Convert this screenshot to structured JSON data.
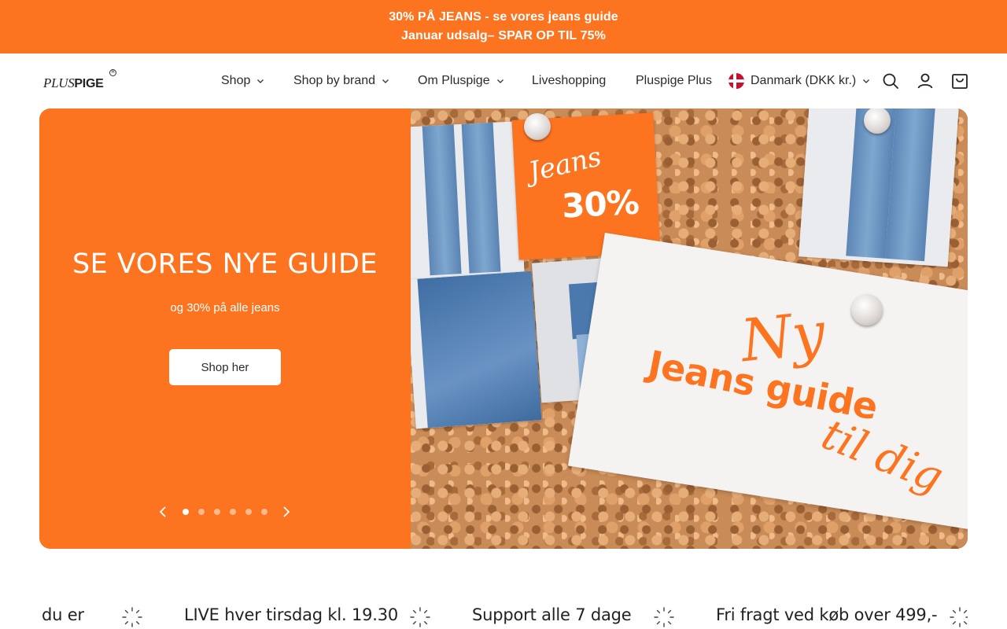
{
  "announcement": {
    "line1": "30% PÅ JEANS - se vores jeans guide",
    "line2": "Januar udsalg– SPAR OP TIL 75%"
  },
  "header": {
    "logo_text": "PLUSPIGE",
    "logo_plus": "PLUS",
    "logo_pige": "PIGE",
    "nav": [
      {
        "label": "Shop",
        "has_dropdown": true
      },
      {
        "label": "Shop by brand",
        "has_dropdown": true
      },
      {
        "label": "Om Pluspige",
        "has_dropdown": true
      },
      {
        "label": "Liveshopping",
        "has_dropdown": false
      },
      {
        "label": "Pluspige Plus",
        "has_dropdown": false
      }
    ],
    "country": {
      "label": "Danmark (DKK kr.)",
      "flag": "denmark-flag"
    },
    "icons": [
      "search-icon",
      "account-icon",
      "cart-icon"
    ]
  },
  "hero": {
    "title": "SE VORES NYE GUIDE",
    "subtitle": "og 30% på alle jeans",
    "button": "Shop her",
    "slide_count": 6,
    "active_slide": 1,
    "image": {
      "card_script": "Jeans",
      "card_percent": "30%",
      "tag_line1": "Ny",
      "tag_line2": "Jeans guide",
      "tag_line3": "til dig"
    }
  },
  "ticker": {
    "items": [
      "du er",
      "LIVE hver tirsdag kl. 19.30",
      "Support alle 7 dage",
      "Fri fragt ved køb over 499,-"
    ]
  },
  "colors": {
    "brand_orange": "#fd7420",
    "text": "#2b2b2b",
    "white": "#ffffff"
  }
}
